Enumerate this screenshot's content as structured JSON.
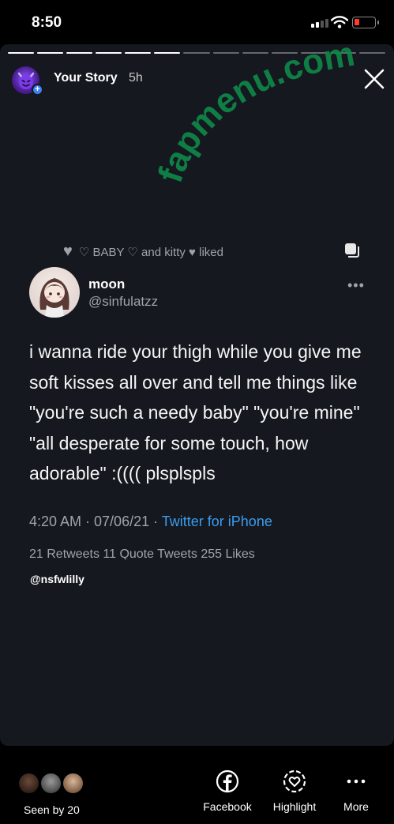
{
  "status": {
    "time": "8:50"
  },
  "story": {
    "user": "Your Story",
    "age": "5h",
    "progress_total": 13,
    "progress_done": 6
  },
  "watermark": {
    "text": "fapmenu.com",
    "color": "#0f8a4a"
  },
  "tweet": {
    "liked_by": "♡ BABY ♡ and kitty ♥ liked",
    "name": "moon",
    "handle": "@sinfulatzz",
    "text": "i wanna ride your thigh while you give me soft kisses all over and tell me things like \"you're such a needy baby\" \"you're mine\" \"all desperate for some touch, how adorable\" :(((( plsplspls",
    "timestamp": "4:20 AM · 07/06/21 · ",
    "source": "Twitter for iPhone",
    "stats_cut": "21 Retweets  11 Quote Tweets  255 Likes"
  },
  "mention": "@nsfwlilly",
  "footer": {
    "seen_label": "Seen by 20",
    "actions": [
      {
        "label": "Facebook",
        "icon": "facebook-icon"
      },
      {
        "label": "Highlight",
        "icon": "highlight-heart-icon"
      },
      {
        "label": "More",
        "icon": "more-dots-icon"
      }
    ]
  },
  "colors": {
    "accent_blue": "#3a9df0",
    "battery_red": "#ff3b30",
    "story_bg": "#15181f"
  }
}
